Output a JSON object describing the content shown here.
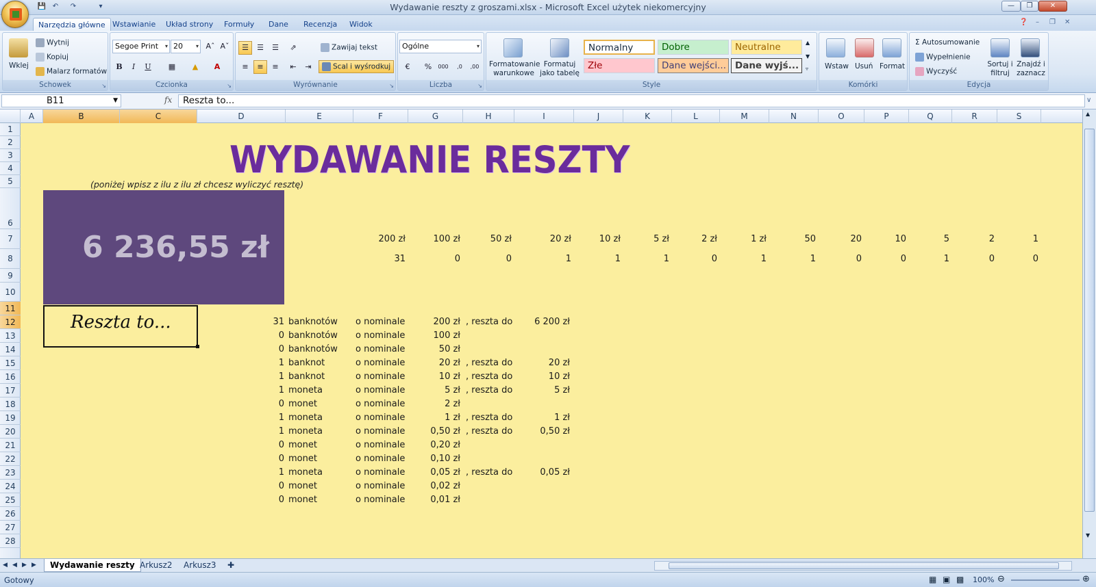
{
  "window": {
    "title": "Wydawanie reszty z groszami.xlsx - Microsoft Excel użytek niekomercyjny"
  },
  "ribbon_tabs": [
    "Narzędzia główne",
    "Wstawianie",
    "Układ strony",
    "Formuły",
    "Dane",
    "Recenzja",
    "Widok"
  ],
  "clipboard": {
    "paste": "Wklej",
    "cut": "Wytnij",
    "copy": "Kopiuj",
    "painter": "Malarz formatów",
    "label": "Schowek"
  },
  "font": {
    "name": "Segoe Print",
    "size": "20",
    "label": "Czcionka",
    "bold": "B",
    "italic": "I",
    "underline": "U"
  },
  "alignment": {
    "wrap": "Zawijaj tekst",
    "merge": "Scal i wyśrodkuj",
    "label": "Wyrównanie"
  },
  "number": {
    "format": "Ogólne",
    "label": "Liczba",
    "percent": "%",
    "thousands": "000"
  },
  "styles": {
    "cond": "Formatowanie warunkowe",
    "table": "Formatuj jako tabelę",
    "label": "Style",
    "items": [
      "Normalny",
      "Dobre",
      "Neutralne",
      "Złe",
      "Dane wejści...",
      "Dane wyjś..."
    ]
  },
  "cells": {
    "insert": "Wstaw",
    "delete": "Usuń",
    "format": "Format",
    "label": "Komórki"
  },
  "editing": {
    "autosum": "Autosumowanie",
    "fill": "Wypełnienie",
    "clear": "Wyczyść",
    "sort": "Sortuj i filtruj",
    "find": "Znajdź i zaznacz",
    "label": "Edycja"
  },
  "formula_bar": {
    "namebox": "B11",
    "fx": "fx",
    "value": "Reszta to..."
  },
  "columns": [
    "A",
    "B",
    "C",
    "D",
    "E",
    "F",
    "G",
    "H",
    "I",
    "J",
    "K",
    "L",
    "M",
    "N",
    "O",
    "P",
    "Q",
    "R",
    "S"
  ],
  "rows": [
    "1",
    "2",
    "3",
    "4",
    "5",
    "6",
    "7",
    "8",
    "9",
    "10",
    "11",
    "12",
    "13",
    "14",
    "15",
    "16",
    "17",
    "18",
    "19",
    "20",
    "21",
    "22",
    "23",
    "24",
    "25",
    "26",
    "27",
    "28"
  ],
  "sheet": {
    "title": "WYDAWANIE RESZTY",
    "hint": "(poniżej wpisz z ilu z ilu zł chcesz wyliczyć resztę)",
    "amount": "6 236,55 zł",
    "reszta_label": "Reszta to...",
    "denominations": [
      "200 zł",
      "100 zł",
      "50 zł",
      "20 zł",
      "10 zł",
      "5 zł",
      "2 zł",
      "1 zł",
      "50",
      "20",
      "10",
      "5",
      "2",
      "1"
    ],
    "counts": [
      "31",
      "0",
      "0",
      "1",
      "1",
      "1",
      "0",
      "1",
      "1",
      "0",
      "0",
      "1",
      "0",
      "0"
    ],
    "breakdown": [
      {
        "count": "31",
        "unit": "banknotów",
        "nominal": "o nominale",
        "value": "200 zł",
        "label": ", reszta do",
        "total": "6 200 zł"
      },
      {
        "count": "0",
        "unit": "banknotów",
        "nominal": "o nominale",
        "value": "100 zł",
        "label": "",
        "total": ""
      },
      {
        "count": "0",
        "unit": "banknotów",
        "nominal": "o nominale",
        "value": "50 zł",
        "label": "",
        "total": ""
      },
      {
        "count": "1",
        "unit": "banknot",
        "nominal": "o nominale",
        "value": "20 zł",
        "label": ", reszta do",
        "total": "20 zł"
      },
      {
        "count": "1",
        "unit": "banknot",
        "nominal": "o nominale",
        "value": "10 zł",
        "label": ", reszta do",
        "total": "10 zł"
      },
      {
        "count": "1",
        "unit": "moneta",
        "nominal": "o nominale",
        "value": "5 zł",
        "label": ", reszta do",
        "total": "5 zł"
      },
      {
        "count": "0",
        "unit": "monet",
        "nominal": "o nominale",
        "value": "2 zł",
        "label": "",
        "total": ""
      },
      {
        "count": "1",
        "unit": "moneta",
        "nominal": "o nominale",
        "value": "1 zł",
        "label": ", reszta do",
        "total": "1 zł"
      },
      {
        "count": "1",
        "unit": "moneta",
        "nominal": "o nominale",
        "value": "0,50 zł",
        "label": ", reszta do",
        "total": "0,50 zł"
      },
      {
        "count": "0",
        "unit": "monet",
        "nominal": "o nominale",
        "value": "0,20 zł",
        "label": "",
        "total": ""
      },
      {
        "count": "0",
        "unit": "monet",
        "nominal": "o nominale",
        "value": "0,10 zł",
        "label": "",
        "total": ""
      },
      {
        "count": "1",
        "unit": "moneta",
        "nominal": "o nominale",
        "value": "0,05 zł",
        "label": ", reszta do",
        "total": "0,05 zł"
      },
      {
        "count": "0",
        "unit": "monet",
        "nominal": "o nominale",
        "value": "0,02 zł",
        "label": "",
        "total": ""
      },
      {
        "count": "0",
        "unit": "monet",
        "nominal": "o nominale",
        "value": "0,01 zł",
        "label": "",
        "total": ""
      }
    ]
  },
  "sheet_tabs": [
    "Wydawanie reszty",
    "Arkusz2",
    "Arkusz3"
  ],
  "status": {
    "ready": "Gotowy",
    "zoom": "100%"
  },
  "colors": {
    "sheet_bg": "#fbee9e",
    "amount_bg": "#5e487d",
    "title": "#6a2c9c"
  }
}
